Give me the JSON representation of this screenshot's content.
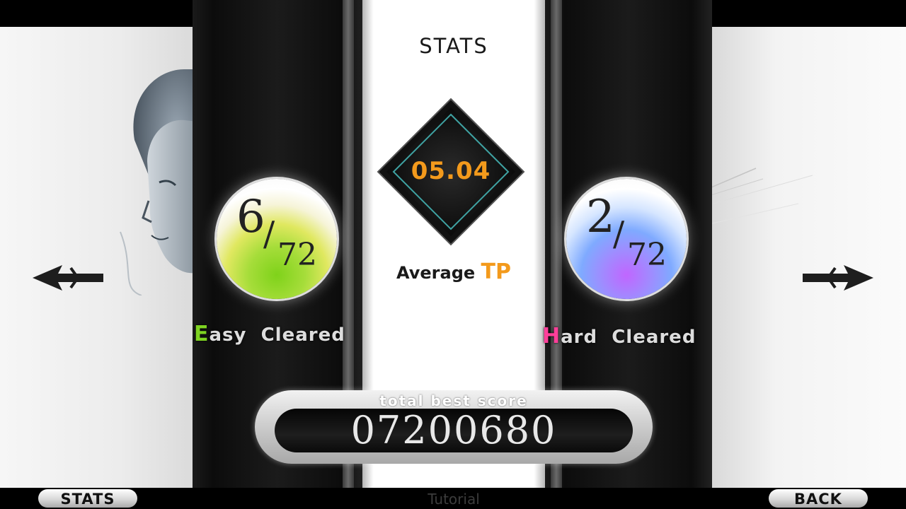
{
  "screen": {
    "title": "STATS"
  },
  "average_tp": {
    "value": "05.04",
    "label_prefix": "Average ",
    "label_accent": "TP"
  },
  "easy": {
    "cleared": "6",
    "total": "72",
    "label_initial": "E",
    "label_rest": "asy  Cleared",
    "accent_color": "#7ed321"
  },
  "hard": {
    "cleared": "2",
    "total": "72",
    "label_initial": "H",
    "label_rest": "ard  Cleared",
    "accent_color": "#ff3f9a"
  },
  "total_best_score": {
    "caption": "total best score",
    "value": "07200680"
  },
  "bottom_bar": {
    "left_button": "STATS",
    "center_label": "Tutorial",
    "right_button": "BACK"
  },
  "icons": {
    "left_arrow": "arrow-left-icon",
    "right_arrow": "arrow-right-icon"
  },
  "colors": {
    "tp_accent": "#f39a1c"
  }
}
